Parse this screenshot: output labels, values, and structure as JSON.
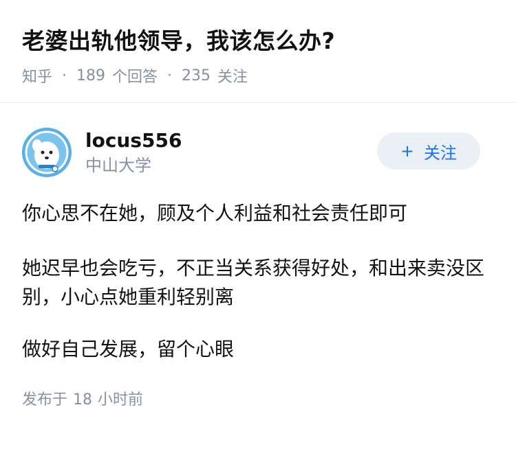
{
  "question": {
    "title": "老婆出轨他领导，我该怎么办?",
    "source": "知乎",
    "answer_count": "189",
    "answer_label": "个回答",
    "follow_count": "235",
    "follow_label": "关注"
  },
  "answer": {
    "author_name": "locus556",
    "author_school": "中山大学",
    "follow_button_plus": "+",
    "follow_button_label": "关注",
    "paragraphs": [
      "你心思不在她，顾及个人利益和社会责任即可",
      "她迟早也会吃亏，不正当关系获得好处，和出来卖没区别，小心点她重利轻别离",
      "做好自己发展，留个心眼"
    ],
    "published_label": "发布于",
    "published_num": "18",
    "published_unit": "小时前"
  },
  "colors": {
    "meta_gray": "#8590a6",
    "link_blue": "#1772f6",
    "button_bg": "#ebf0f7",
    "avatar_bg": "#5ab0e6"
  }
}
